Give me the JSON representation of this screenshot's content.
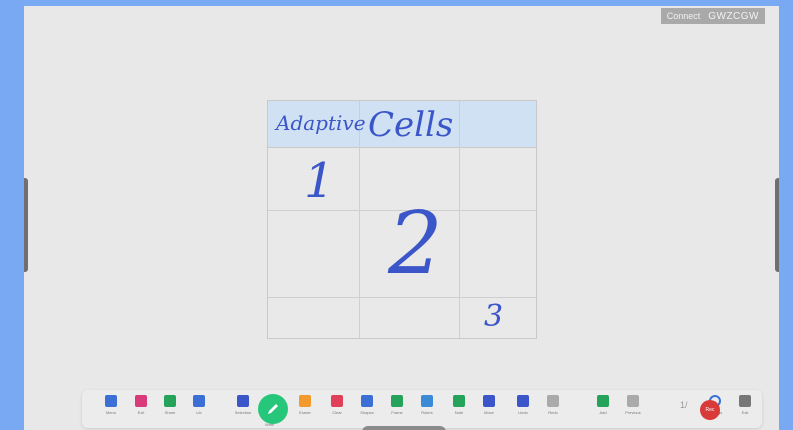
{
  "connect": {
    "label": "Connect",
    "code": "GWZCGW"
  },
  "table": {
    "header": [
      "Adaptive",
      "Cells",
      ""
    ],
    "cells": [
      "1",
      "2",
      "3"
    ]
  },
  "toolbar": {
    "items": [
      {
        "label": "Menu",
        "icon": "menu-icon"
      },
      {
        "label": "Exit",
        "icon": "close-icon"
      },
      {
        "label": "Share",
        "icon": "grid-icon"
      },
      {
        "label": "Lib",
        "icon": "library-icon"
      },
      {
        "label": "Selection",
        "icon": "cursor-icon"
      },
      {
        "label": "Write",
        "icon": "pen-icon"
      },
      {
        "label": "Eraser",
        "icon": "eraser-icon"
      },
      {
        "label": "Clear",
        "icon": "broom-icon"
      },
      {
        "label": "Shapes",
        "icon": "shapes-icon"
      },
      {
        "label": "Frame",
        "icon": "frame-icon"
      },
      {
        "label": "Rulers",
        "icon": "ruler-icon"
      },
      {
        "label": "Note",
        "icon": "note-icon"
      },
      {
        "label": "Move",
        "icon": "hand-icon"
      },
      {
        "label": "Undo",
        "icon": "undo-icon"
      },
      {
        "label": "Redo",
        "icon": "redo-icon"
      },
      {
        "label": "Add",
        "icon": "add-page-icon"
      },
      {
        "label": "Previous",
        "icon": "previous-icon"
      },
      {
        "label": "Settings",
        "icon": "settings-icon"
      },
      {
        "label": "Exit",
        "icon": "exit-icon"
      }
    ],
    "page": "1/",
    "record_label": "Rec"
  },
  "colors": {
    "accent_green": "#26c77a",
    "ink_blue": "#3b56c8",
    "record_red": "#d83a3a"
  }
}
